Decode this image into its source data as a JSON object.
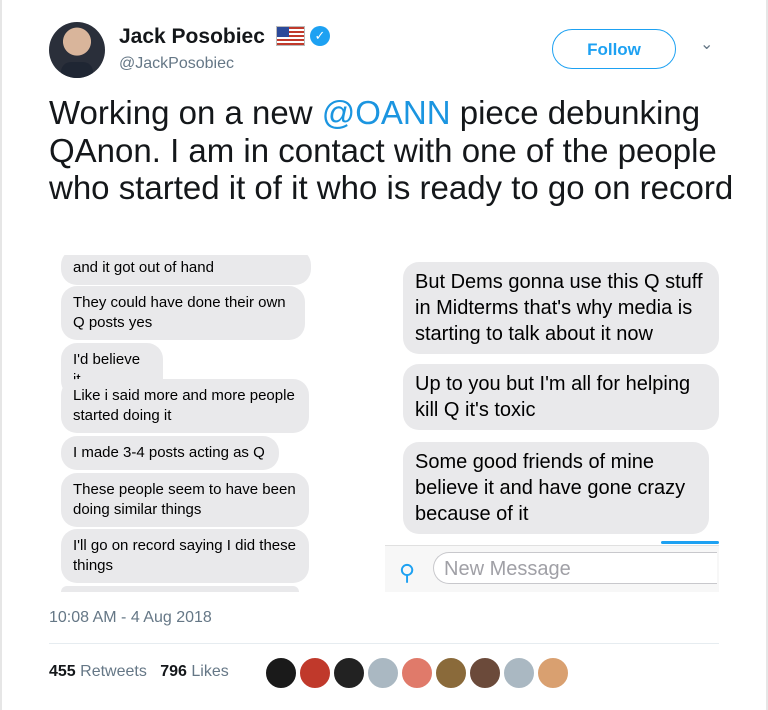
{
  "author": {
    "name": "Jack Posobiec",
    "handle": "@JackPosobiec"
  },
  "follow_label": "Follow",
  "tweet": {
    "before": "Working on a new ",
    "mention": "@OANN",
    "after": " piece debunking QAnon. I am in contact with one of the people who started it of it who is ready to go on record"
  },
  "screenshot": {
    "left_messages": [
      "and it got out of hand",
      "They could have done their own Q posts yes",
      "I'd believe it",
      "Like i said more and more people started doing it",
      "I made 3-4 posts acting as Q",
      "These people seem to have been doing similar things",
      "I'll go on record saying I did these things"
    ],
    "right_messages": [
      "But Dems gonna use this Q stuff in Midterms that's why media is starting to talk about it now",
      "Up to you but I'm all for helping kill Q it's toxic",
      "Some good friends of mine believe it and have gone crazy because of it"
    ],
    "composer_placeholder": "New Message"
  },
  "timestamp": "10:08 AM - 4 Aug 2018",
  "stats": {
    "retweets_count": "455",
    "retweets_label": "Retweets",
    "likes_count": "796",
    "likes_label": "Likes"
  },
  "liker_colors": [
    "#1a1a1a",
    "#c0392b",
    "#222222",
    "#aab8c2",
    "#e07a6a",
    "#8a6a3a",
    "#6b4a3a",
    "#aab8c2",
    "#d9a070"
  ]
}
